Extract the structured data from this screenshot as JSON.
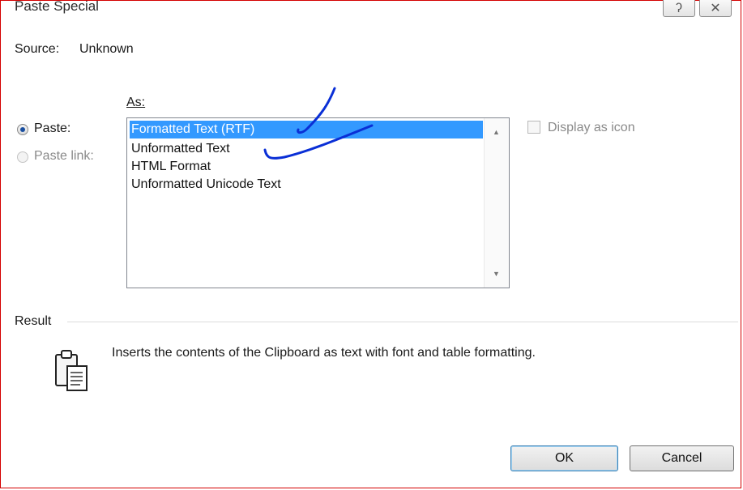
{
  "window": {
    "title": "Paste Special",
    "help_glyph": "ʔ",
    "close_glyph": "✕",
    "help_icon": "help-icon",
    "close_icon": "close-icon"
  },
  "source": {
    "label": "Source:",
    "value": "Unknown"
  },
  "paste_options": [
    {
      "label": "Paste:",
      "checked": true,
      "enabled": true
    },
    {
      "label": "Paste link:",
      "checked": false,
      "enabled": false
    }
  ],
  "as_label": "As:",
  "formats": [
    {
      "label": "Formatted Text (RTF)",
      "selected": true
    },
    {
      "label": "Unformatted Text",
      "selected": false
    },
    {
      "label": "HTML Format",
      "selected": false
    },
    {
      "label": "Unformatted Unicode Text",
      "selected": false
    }
  ],
  "display_as_icon": {
    "label": "Display as icon",
    "checked": false,
    "enabled": false
  },
  "result": {
    "label": "Result",
    "description": "Inserts the contents of the Clipboard as text with font and table formatting.",
    "icon": "clipboard-document-icon"
  },
  "buttons": {
    "ok": "OK",
    "cancel": "Cancel"
  },
  "colors": {
    "selection": "#3399ff",
    "annotation_ink": "#0a2fd6",
    "window_border": "#d40000"
  }
}
